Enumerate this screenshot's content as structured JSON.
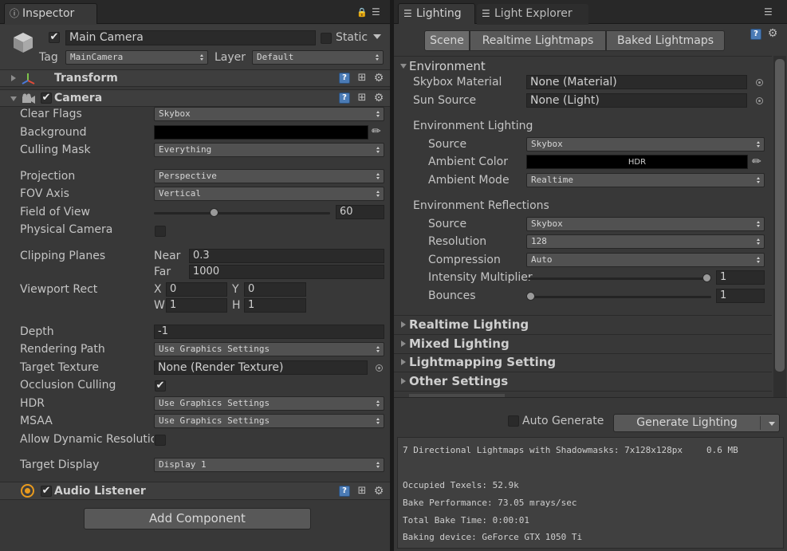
{
  "inspector": {
    "tab_label": "Inspector",
    "object": {
      "name": "Main Camera",
      "static_label": "Static",
      "tag_label": "Tag",
      "tag_value": "MainCamera",
      "layer_label": "Layer",
      "layer_value": "Default"
    },
    "transform": {
      "title": "Transform"
    },
    "camera": {
      "title": "Camera",
      "clear_flags_label": "Clear Flags",
      "clear_flags_value": "Skybox",
      "background_label": "Background",
      "culling_mask_label": "Culling Mask",
      "culling_mask_value": "Everything",
      "projection_label": "Projection",
      "projection_value": "Perspective",
      "fov_axis_label": "FOV Axis",
      "fov_axis_value": "Vertical",
      "field_of_view_label": "Field of View",
      "field_of_view_value": "60",
      "physical_camera_label": "Physical Camera",
      "clipping_planes_label": "Clipping Planes",
      "near_label": "Near",
      "near_value": "0.3",
      "far_label": "Far",
      "far_value": "1000",
      "viewport_rect_label": "Viewport Rect",
      "x_label": "X",
      "x_value": "0",
      "y_label": "Y",
      "y_value": "0",
      "w_label": "W",
      "w_value": "1",
      "h_label": "H",
      "h_value": "1",
      "depth_label": "Depth",
      "depth_value": "-1",
      "rendering_path_label": "Rendering Path",
      "rendering_path_value": "Use Graphics Settings",
      "target_texture_label": "Target Texture",
      "target_texture_value": "None (Render Texture)",
      "occlusion_culling_label": "Occlusion Culling",
      "hdr_label": "HDR",
      "hdr_value": "Use Graphics Settings",
      "msaa_label": "MSAA",
      "msaa_value": "Use Graphics Settings",
      "allow_dynamic_label": "Allow Dynamic Resolutio",
      "target_display_label": "Target Display",
      "target_display_value": "Display 1"
    },
    "audio_listener": {
      "title": "Audio Listener"
    },
    "add_component_label": "Add Component"
  },
  "lighting": {
    "tabs": [
      {
        "label": "Lighting"
      },
      {
        "label": "Light Explorer"
      }
    ],
    "segments": [
      {
        "label": "Scene"
      },
      {
        "label": "Realtime Lightmaps"
      },
      {
        "label": "Baked Lightmaps"
      }
    ],
    "environment": {
      "title": "Environment",
      "skybox_material_label": "Skybox Material",
      "skybox_material_value": "None (Material)",
      "sun_source_label": "Sun Source",
      "sun_source_value": "None (Light)",
      "env_lighting_title": "Environment Lighting",
      "source_label": "Source",
      "source_value": "Skybox",
      "ambient_color_label": "Ambient Color",
      "ambient_color_text": "HDR",
      "ambient_mode_label": "Ambient Mode",
      "ambient_mode_value": "Realtime",
      "env_reflections_title": "Environment Reflections",
      "refl_source_label": "Source",
      "refl_source_value": "Skybox",
      "resolution_label": "Resolution",
      "resolution_value": "128",
      "compression_label": "Compression",
      "compression_value": "Auto",
      "intensity_label": "Intensity Multiplier",
      "intensity_value": "1",
      "bounces_label": "Bounces",
      "bounces_value": "1"
    },
    "sections": [
      {
        "title": "Realtime Lighting"
      },
      {
        "title": "Mixed Lighting"
      },
      {
        "title": "Lightmapping Setting"
      },
      {
        "title": "Other Settings"
      }
    ],
    "auto_generate_label": "Auto Generate",
    "generate_lighting_label": "Generate Lighting",
    "stats": {
      "lightmaps_line": "7 Directional Lightmaps with Shadowmasks: 7x128x128px",
      "lightmaps_size": "0.6 MB",
      "occupied_texels": "Occupied Texels: 52.9k",
      "bake_performance": "Bake Performance: 73.05 mrays/sec",
      "total_bake_time": "Total Bake Time: 0:00:01",
      "baking_device": "Baking device: GeForce GTX 1050 Ti"
    }
  }
}
